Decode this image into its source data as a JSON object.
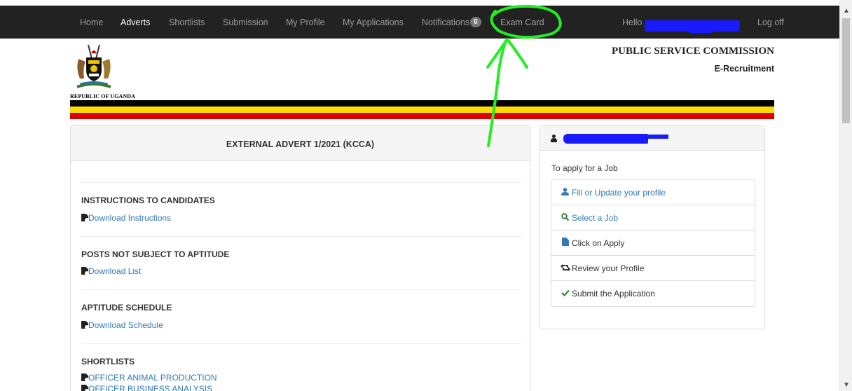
{
  "nav": {
    "items": [
      {
        "label": "Home",
        "active": false
      },
      {
        "label": "Adverts",
        "active": true
      },
      {
        "label": "Shortlists",
        "active": false
      },
      {
        "label": "Submission",
        "active": false
      },
      {
        "label": "My Profile",
        "active": false
      },
      {
        "label": "My Applications",
        "active": false
      },
      {
        "label": "Notifications",
        "active": false
      },
      {
        "label": "Exam Card",
        "active": false
      }
    ],
    "notification_count": "0",
    "greeting": "Hello",
    "logoff": "Log off"
  },
  "header": {
    "republic": "REPUBLIC OF UGANDA",
    "org": "PUBLIC SERVICE COMMISSION",
    "system": "E-Recruitment"
  },
  "flag_colors": [
    "#000000",
    "#FCDC04",
    "#D90000"
  ],
  "advert": {
    "title": "EXTERNAL ADVERT 1/2021 (KCCA)",
    "sections": [
      {
        "title": "INSTRUCTIONS TO CANDIDATES",
        "links": [
          "Download Instructions"
        ]
      },
      {
        "title": "POSTS NOT SUBJECT TO APTITUDE",
        "links": [
          "Download List"
        ]
      },
      {
        "title": "APTITUDE SCHEDULE",
        "links": [
          "Download Schedule"
        ]
      },
      {
        "title": "SHORTLISTS",
        "links": [
          "OFFICER ANIMAL PRODUCTION",
          "OFFICER BUSINESS ANALYSIS"
        ]
      }
    ]
  },
  "side": {
    "intro": "To apply for a Job",
    "steps": [
      {
        "label": "Fill or Update your profile",
        "icon": "user-icon",
        "link": true
      },
      {
        "label": "Select a Job",
        "icon": "search-icon",
        "link": true
      },
      {
        "label": "Click on Apply",
        "icon": "file-icon",
        "link": false
      },
      {
        "label": "Review your Profile",
        "icon": "retweet-icon",
        "link": false
      },
      {
        "label": "Submit the Application",
        "icon": "check-icon",
        "link": false
      }
    ]
  },
  "colors": {
    "navbar": "#222222",
    "link": "#337ab7",
    "annotation": "#22ee22",
    "redaction": "#1a1aff"
  }
}
